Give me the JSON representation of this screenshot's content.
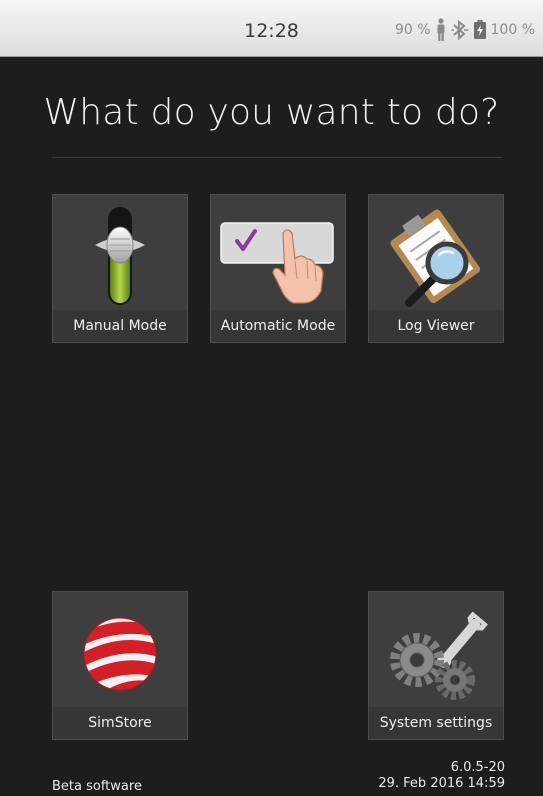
{
  "status_bar": {
    "time": "12:28",
    "signal_percent": "90 %",
    "battery_percent": "100 %"
  },
  "page": {
    "title": "What do you want to do?"
  },
  "tiles": [
    {
      "label": "Manual Mode",
      "icon": "slider-switch-icon"
    },
    {
      "label": "Automatic Mode",
      "icon": "touch-checkbox-icon"
    },
    {
      "label": "Log Viewer",
      "icon": "clipboard-magnifier-icon"
    },
    {
      "label": "SimStore",
      "icon": "striped-globe-icon"
    },
    {
      "label": "System settings",
      "icon": "gears-wrench-icon"
    }
  ],
  "footer": {
    "left_text": "Beta software",
    "version": "6.0.5-20",
    "date": "29. Feb 2016 14:59"
  }
}
